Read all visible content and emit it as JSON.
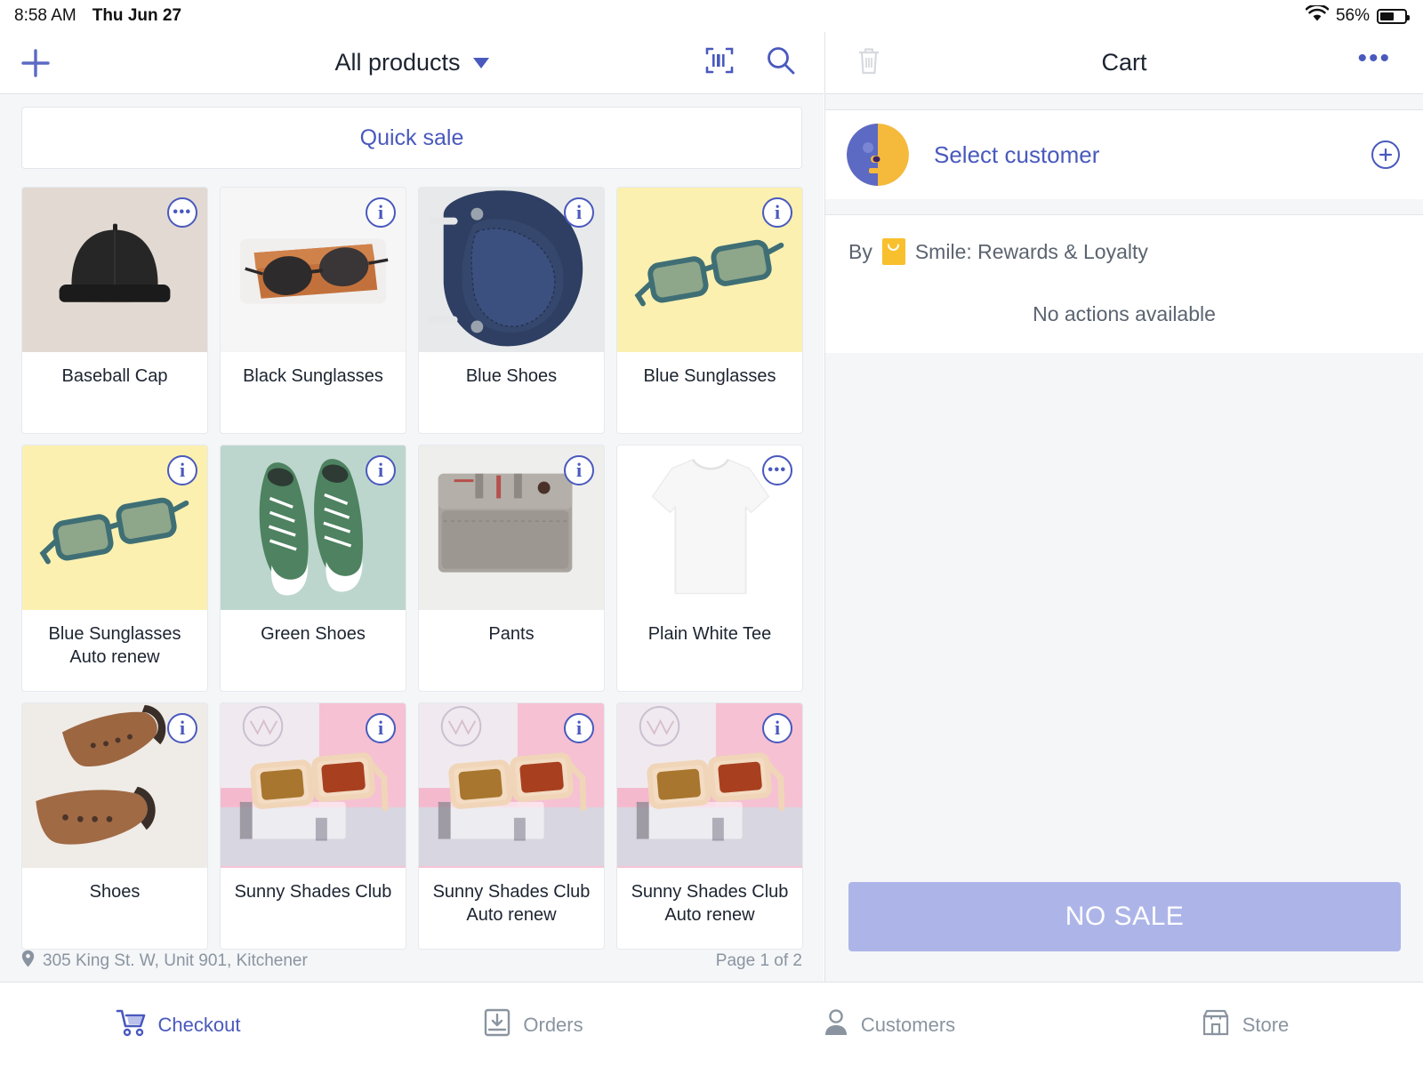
{
  "statusbar": {
    "time": "8:58 AM",
    "date": "Thu Jun 27",
    "battery_percent": "56%",
    "wifi_icon": "wifi-icon",
    "battery_icon": "battery-icon"
  },
  "left_header": {
    "add_icon": "plus-icon",
    "title": "All products",
    "caret_icon": "chevron-down-icon",
    "barcode_icon": "barcode-scan-icon",
    "search_icon": "search-icon"
  },
  "quick_sale": {
    "label": "Quick sale"
  },
  "products": [
    {
      "name": "Baseball Cap",
      "badge": "dots",
      "bg": "#e2d9d2",
      "art": "cap"
    },
    {
      "name": "Black Sunglasses",
      "badge": "info",
      "bg": "#f4f4f4",
      "art": "black-sunglasses"
    },
    {
      "name": "Blue Shoes",
      "badge": "info",
      "bg": "#e8e9ea",
      "art": "blue-shoe"
    },
    {
      "name": "Blue Sunglasses",
      "badge": "info",
      "bg": "#fbf0b0",
      "art": "blue-sunglasses"
    },
    {
      "name": "Blue Sunglasses\nAuto renew",
      "badge": "info",
      "bg": "#fbf0b0",
      "art": "blue-sunglasses"
    },
    {
      "name": "Green Shoes",
      "badge": "info",
      "bg": "#bcd6cd",
      "art": "green-shoes"
    },
    {
      "name": "Pants",
      "badge": "info",
      "bg": "#eeeeec",
      "art": "pants"
    },
    {
      "name": "Plain White Tee",
      "badge": "dots",
      "bg": "#ffffff",
      "art": "white-tee"
    },
    {
      "name": "Shoes",
      "badge": "info",
      "bg": "#efebe7",
      "art": "brown-boots"
    },
    {
      "name": "Sunny Shades Club",
      "badge": "info",
      "bg": "#f6c3d4",
      "art": "sunny-shades"
    },
    {
      "name": "Sunny Shades Club\nAuto renew",
      "badge": "info",
      "bg": "#f6c3d4",
      "art": "sunny-shades"
    },
    {
      "name": "Sunny Shades Club\nAuto renew",
      "badge": "info",
      "bg": "#f6c3d4",
      "art": "sunny-shades"
    }
  ],
  "left_footer": {
    "location_icon": "map-pin-icon",
    "location": "305 King St. W, Unit 901, Kitchener",
    "page": "Page 1 of 2"
  },
  "cart": {
    "delete_icon": "trash-icon",
    "title": "Cart",
    "more_icon": "ellipsis-icon",
    "customer": {
      "avatar_icon": "customer-avatar-icon",
      "select_label": "Select customer",
      "add_icon": "plus-circle-icon"
    },
    "app": {
      "by_label": "By",
      "app_icon": "smile-app-icon",
      "app_name": "Smile: Rewards & Loyalty",
      "empty_state": "No actions available"
    },
    "no_sale_label": "NO SALE"
  },
  "bottom_nav": [
    {
      "label": "Checkout",
      "icon": "shopping-cart-icon",
      "active": true
    },
    {
      "label": "Orders",
      "icon": "orders-inbox-icon",
      "active": false
    },
    {
      "label": "Customers",
      "icon": "person-icon",
      "active": false
    },
    {
      "label": "Store",
      "icon": "storefront-icon",
      "active": false
    }
  ],
  "colors": {
    "accent": "#4959bd",
    "accent_light": "#adb5e8",
    "page_bg": "#f4f6f8",
    "text": "#1c2430",
    "muted": "#8a94a0",
    "smile_yellow": "#f9c02e"
  }
}
